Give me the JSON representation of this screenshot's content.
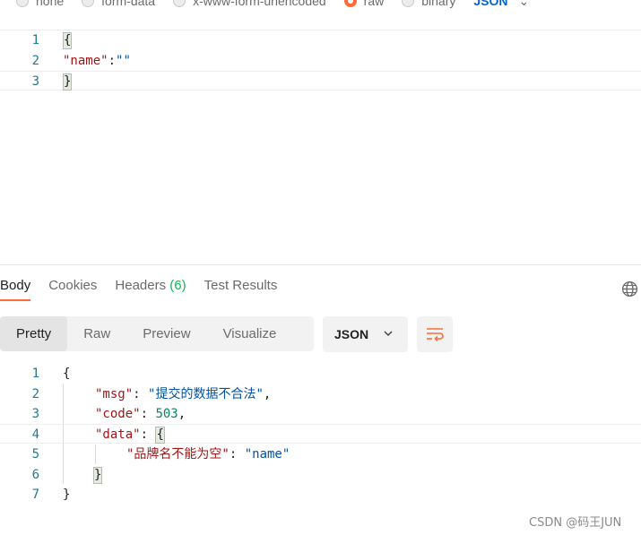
{
  "body_types": {
    "options": [
      "none",
      "form-data",
      "x-www-form-urlencoded",
      "raw",
      "binary"
    ],
    "selected": "raw",
    "format": "JSON"
  },
  "request": {
    "lines": [
      {
        "num": "1",
        "text": "{"
      },
      {
        "num": "2",
        "key": "\"name\"",
        "sep": ":",
        "value": "\"\""
      },
      {
        "num": "3",
        "text": "}"
      }
    ]
  },
  "response": {
    "tabs": [
      {
        "label": "Body"
      },
      {
        "label": "Cookies"
      },
      {
        "label": "Headers",
        "count": "(6)"
      },
      {
        "label": "Test Results"
      }
    ],
    "active_tab": "Body",
    "view_modes": [
      "Pretty",
      "Raw",
      "Preview",
      "Visualize"
    ],
    "active_view": "Pretty",
    "format": "JSON",
    "lines": [
      {
        "num": "1",
        "text": "{"
      },
      {
        "num": "2",
        "key": "\"msg\"",
        "sep": ": ",
        "value": "\"提交的数据不合法\"",
        "tail": ","
      },
      {
        "num": "3",
        "key": "\"code\"",
        "sep": ": ",
        "value": "503",
        "tail": ","
      },
      {
        "num": "4",
        "key": "\"data\"",
        "sep": ": ",
        "value": "{"
      },
      {
        "num": "5",
        "key": "\"品牌名不能为空\"",
        "sep": ": ",
        "value": "\"name\""
      },
      {
        "num": "6",
        "text": "}"
      },
      {
        "num": "7",
        "text": "}"
      }
    ]
  },
  "watermark": "CSDN @码王JUN",
  "colors": {
    "accent": "#ff6c37",
    "json_key": "#a31515",
    "json_string": "#0451a5",
    "json_number": "#098658",
    "count": "#0cbb52"
  }
}
